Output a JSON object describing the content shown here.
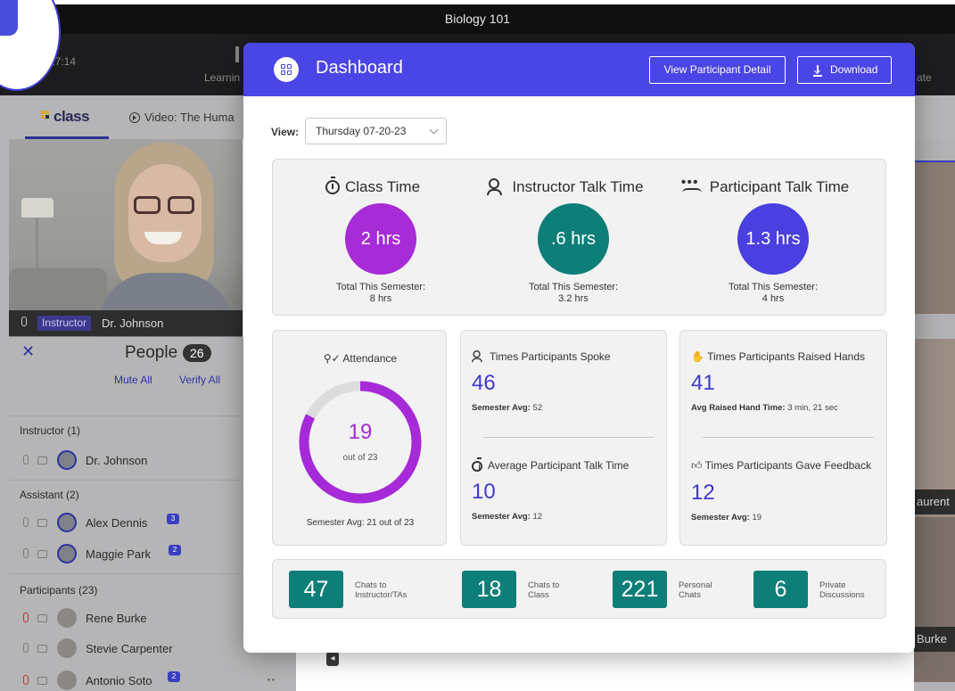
{
  "window": {
    "title": "Biology 101"
  },
  "toolbar": {
    "timer": "27:14",
    "learn_label": "Learnin",
    "right_label": "ate"
  },
  "tabs": {
    "class_label": "class",
    "video_label": "Video: The Huma"
  },
  "video": {
    "role_badge": "Instructor",
    "speaker_name": "Dr. Johnson"
  },
  "people": {
    "title": "People",
    "count": "26",
    "mute_all": "Mute All",
    "verify_all": "Verify All",
    "sections": {
      "instructor": "Instructor (1)",
      "assistant": "Assistant (2)",
      "participants": "Participants (23)"
    },
    "members": [
      {
        "name": "Dr. Johnson"
      },
      {
        "name": "Alex Dennis",
        "badge": "3"
      },
      {
        "name": "Maggie Park",
        "badge": "2"
      },
      {
        "name": "Rene Burke"
      },
      {
        "name": "Stevie Carpenter"
      },
      {
        "name": "Antonio Soto",
        "badge": "2"
      }
    ]
  },
  "right_tiles": {
    "label1": "aurent",
    "label2": "Burke"
  },
  "modal": {
    "title": "Dashboard",
    "view_participant_label": "View Participant Detail",
    "download_label": "Download",
    "view_label": "View:",
    "view_value": "Thursday 07-20-23"
  },
  "metrics": [
    {
      "title": "Class Time",
      "value": "2 hrs",
      "sub_label": "Total This Semester:",
      "sub_value": "8 hrs",
      "color": "#a72bd6"
    },
    {
      "title": "Instructor Talk Time",
      "value": ".6 hrs",
      "sub_label": "Total This Semester:",
      "sub_value": "3.2 hrs",
      "color": "#0e7f78"
    },
    {
      "title": "Participant Talk Time",
      "value": "1.3 hrs",
      "sub_label": "Total This Semester:",
      "sub_value": "4 hrs",
      "color": "#4a3fe0"
    }
  ],
  "attendance": {
    "title": "Attendance",
    "present": "19",
    "total_label": "out of 23",
    "semester_avg": "Semester Avg: 21 out of 23",
    "fraction": 0.826,
    "color": "#a62ad8"
  },
  "stats": {
    "spoke": {
      "title": "Times Participants Spoke",
      "value": "46",
      "avg_label": "Semester Avg:",
      "avg_value": "52"
    },
    "avg_talk": {
      "title": "Average Participant Talk Time",
      "value": "10",
      "avg_label": "Semester Avg:",
      "avg_value": "12"
    },
    "raised": {
      "title": "Times Participants Raised Hands",
      "value": "41",
      "avg_label": "Avg Raised Hand Time:",
      "avg_value": "3 min, 21 sec"
    },
    "feedback": {
      "title": "Times Participants Gave Feedback",
      "value": "12",
      "avg_label": "Semester Avg:",
      "avg_value": "19"
    }
  },
  "chats": [
    {
      "value": "47",
      "line1": "Chats to",
      "line2": "Instructor/TAs"
    },
    {
      "value": "18",
      "line1": "Chats to",
      "line2": "Class"
    },
    {
      "value": "221",
      "line1": "Personal",
      "line2": "Chats"
    },
    {
      "value": "6",
      "line1": "Private",
      "line2": "Discussions"
    }
  ],
  "colors": {
    "accent": "#4a45e6",
    "teal": "#0e7f78",
    "purple": "#a72bd6",
    "indigo": "#3d3acc"
  }
}
